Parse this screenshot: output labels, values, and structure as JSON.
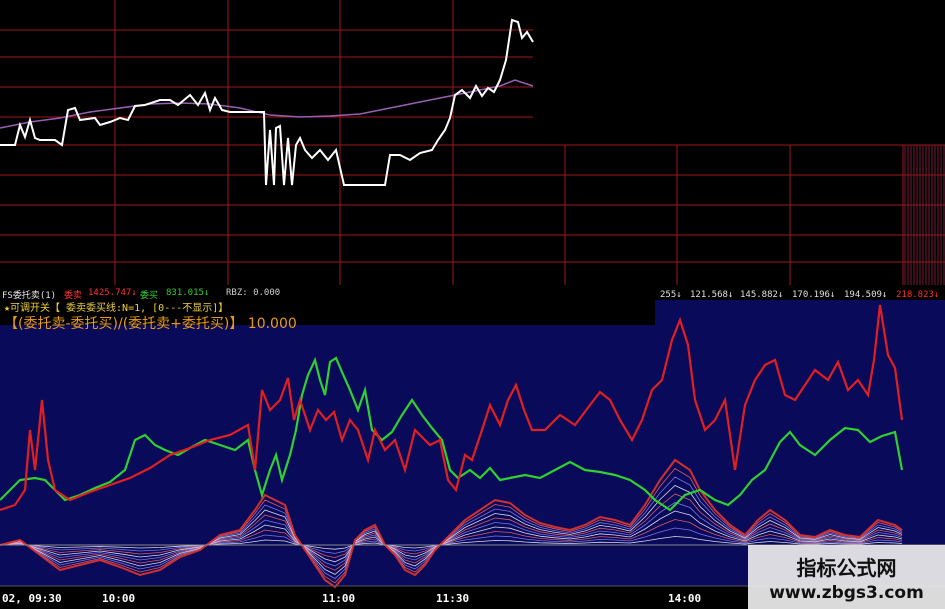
{
  "upper_panel": {
    "price_line_color": "#ffffff",
    "avg_line_color": "#9a5fb5",
    "grid_color": "#a01818"
  },
  "indicator_header": {
    "name": "FS委托卖(1)",
    "weimai_label": "委卖",
    "weimai_value": "1425.747↓",
    "weimai_color": "#ff3030",
    "weimai2_label": "委买",
    "weimai2_value": "831.015↓",
    "weimai2_color": "#30d030",
    "extra_label": "RBZ: 0.000",
    "right_values": [
      "255↓",
      "121.568↓",
      "145.882↓",
      "170.196↓",
      "194.509↓",
      "218.823↓"
    ]
  },
  "formula_header": {
    "line1": "★可调开关【 委卖委买线:N=1, [0---不显示]】",
    "line2": "【(委托卖-委托买)/(委托卖+委托买)】  10.000"
  },
  "time_axis": {
    "labels": [
      "02, 09:30",
      "10:00",
      "11:00",
      "11:30",
      "14:00"
    ]
  },
  "watermark": {
    "title": "指标公式网",
    "url": "www.zbgs3.com"
  },
  "colors": {
    "indicator_bg": "#0a0a5a",
    "sell_line": "#e02020",
    "buy_line": "#30d030"
  }
}
